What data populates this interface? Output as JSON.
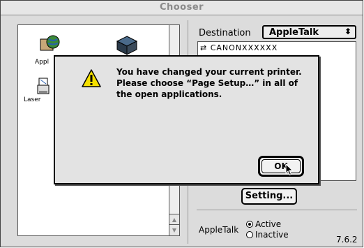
{
  "window": {
    "title": "Chooser"
  },
  "left_pane": {
    "items": [
      {
        "label": "Appl",
        "icon": "appleshare-icon"
      },
      {
        "label": "",
        "icon": "printer-cube-icon"
      },
      {
        "label": "Laser",
        "icon": "laserwriter-icon"
      }
    ]
  },
  "right_pane": {
    "destination_label": "Destination",
    "destination_value": "AppleTalk",
    "destination_chevron": "⬍",
    "list_item": "⇄ CANONXXXXXX",
    "setting_button": "Setting...",
    "appletalk_label": "AppleTalk",
    "active_label": "Active",
    "inactive_label": "Inactive",
    "version": "7.6.2"
  },
  "alert": {
    "icon": "caution-icon",
    "message": "You have changed your current printer. Please choose “Page Setup…” in all of the open applications.",
    "ok_label": "OK"
  }
}
